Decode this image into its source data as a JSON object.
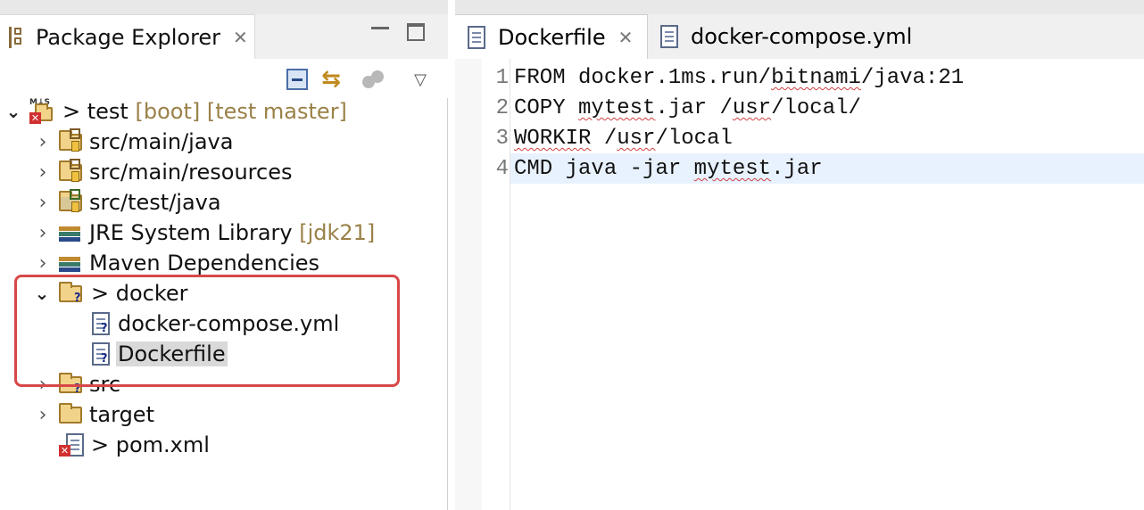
{
  "package_explorer": {
    "tab_title": "Package Explorer",
    "close_glyph": "✕",
    "toolbar": {
      "collapse_all_icon": "collapse-all-icon",
      "link_editor_icon": "link-with-editor-icon",
      "link_glyph": "⇆",
      "filter_icon": "focus-filter-icon",
      "view_menu_glyph": "▽"
    },
    "tree": {
      "project": {
        "prefix": "> ",
        "name": "test",
        "decoration": " [boot] [test master]"
      },
      "items": [
        {
          "label": "src/main/java"
        },
        {
          "label": "src/main/resources"
        },
        {
          "label": "src/test/java"
        },
        {
          "label": "JRE System Library",
          "decoration": " [jdk21]"
        },
        {
          "label": "Maven Dependencies"
        },
        {
          "label": "> docker"
        },
        {
          "label": "docker-compose.yml"
        },
        {
          "label": "Dockerfile"
        },
        {
          "label": "src"
        },
        {
          "label": "target"
        },
        {
          "label": "> pom.xml"
        }
      ]
    },
    "colors": {
      "highlight_box": "#d84848",
      "decoration_text": "#9a8148"
    }
  },
  "editor": {
    "tabs": [
      {
        "label": "Dockerfile",
        "active": true
      },
      {
        "label": "docker-compose.yml",
        "active": false
      }
    ],
    "close_glyph": "✕",
    "lines": [
      {
        "num": "1",
        "text": "FROM docker.1ms.run/bitnami/java:21"
      },
      {
        "num": "2",
        "text": "COPY mytest.jar /usr/local/"
      },
      {
        "num": "3",
        "text": "WORKIR /usr/local"
      },
      {
        "num": "4",
        "text": "CMD java -jar mytest.jar"
      }
    ],
    "colors": {
      "current_line": "#e8f2fe"
    }
  }
}
